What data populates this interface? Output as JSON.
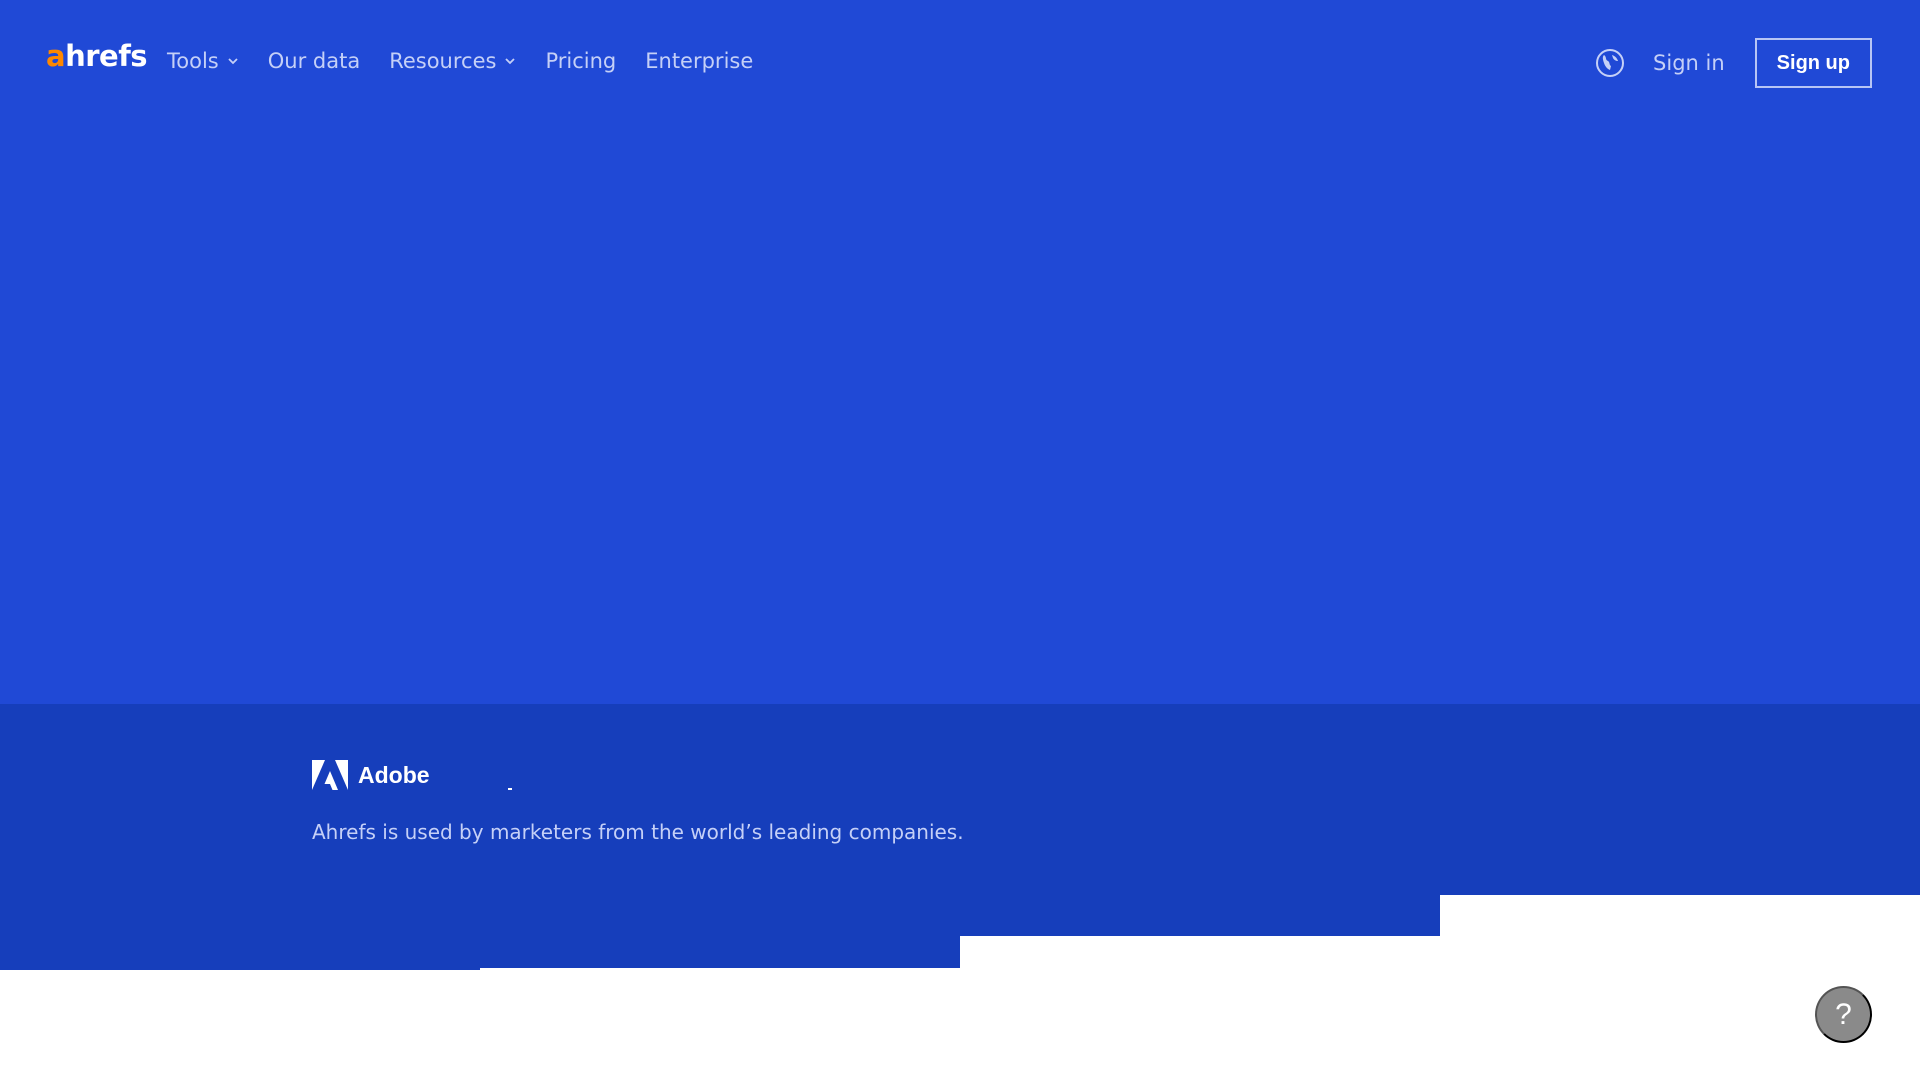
{
  "header": {
    "logo": {
      "accent": "a",
      "rest": "hrefs"
    },
    "nav": [
      {
        "label": "Tools",
        "dropdown": true
      },
      {
        "label": "Our data",
        "dropdown": false
      },
      {
        "label": "Resources",
        "dropdown": true
      },
      {
        "label": "Pricing",
        "dropdown": false
      },
      {
        "label": "Enterprise",
        "dropdown": false
      }
    ],
    "language_icon": "globe-icon",
    "signin_label": "Sign in",
    "signup_label": "Sign up"
  },
  "logos_band": {
    "logo_name": "Adobe",
    "caption": "Ahrefs is used by marketers from the world’s leading companies."
  },
  "help": {
    "label": "?",
    "icon": "question-icon"
  },
  "colors": {
    "hero_bg": "#2049d6",
    "band_bg": "#163ebb",
    "logo_accent": "#ff8800",
    "nav_text": "#c5d0f7",
    "help_bg": "#8a8a8a"
  }
}
